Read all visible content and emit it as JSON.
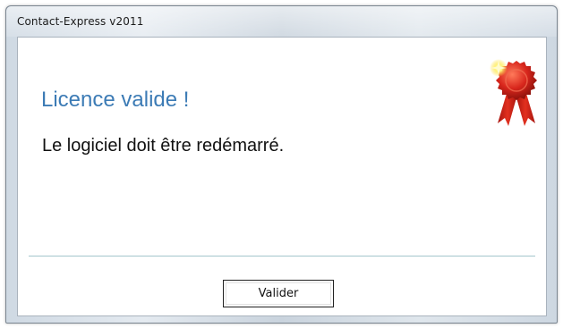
{
  "window": {
    "title": "Contact-Express v2011"
  },
  "dialog": {
    "heading": "Licence valide !",
    "message": "Le logiciel doit être redémarré.",
    "ok_label": "Valider",
    "icon": "award-ribbon-icon"
  },
  "colors": {
    "heading": "#3c7bb5",
    "ribbon": "#d8261c",
    "separator": "#a3c6cc"
  }
}
